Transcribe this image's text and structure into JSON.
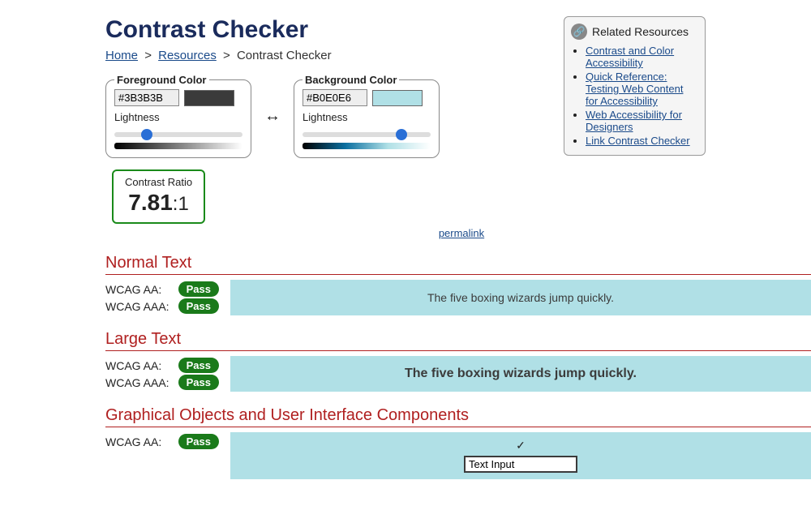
{
  "title": "Contrast Checker",
  "breadcrumb": {
    "home": "Home",
    "resources": "Resources",
    "current": "Contrast Checker"
  },
  "foreground": {
    "legend": "Foreground Color",
    "hex": "#3B3B3B",
    "lightness_label": "Lightness",
    "slider_value": 23
  },
  "background": {
    "legend": "Background Color",
    "hex": "#B0E0E6",
    "lightness_label": "Lightness",
    "slider_value": 80
  },
  "ratio": {
    "label": "Contrast Ratio",
    "value": "7.81",
    "suffix": ":1",
    "permalink": "permalink"
  },
  "sections": {
    "normal": {
      "heading": "Normal Text",
      "aa_label": "WCAG AA:",
      "aa_status": "Pass",
      "aaa_label": "WCAG AAA:",
      "aaa_status": "Pass",
      "sample": "The five boxing wizards jump quickly."
    },
    "large": {
      "heading": "Large Text",
      "aa_label": "WCAG AA:",
      "aa_status": "Pass",
      "aaa_label": "WCAG AAA:",
      "aaa_status": "Pass",
      "sample": "The five boxing wizards jump quickly."
    },
    "gui": {
      "heading": "Graphical Objects and User Interface Components",
      "aa_label": "WCAG AA:",
      "aa_status": "Pass",
      "input_value": "Text Input"
    }
  },
  "sidebar": {
    "heading": "Related Resources",
    "links": [
      "Contrast and Color Accessibility",
      "Quick Reference: Testing Web Content for Accessibility",
      "Web Accessibility for Designers",
      "Link Contrast Checker"
    ]
  }
}
